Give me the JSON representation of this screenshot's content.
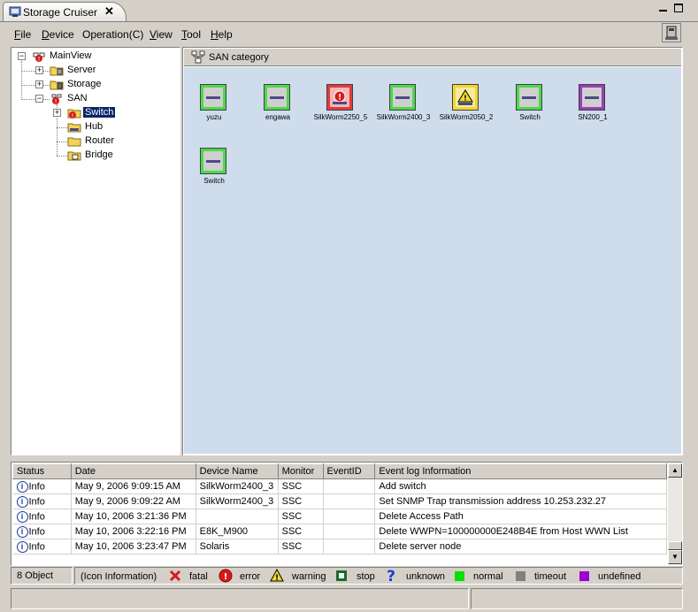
{
  "window": {
    "title": "Storage Cruiser",
    "close_glyph": "✕"
  },
  "menu": {
    "file": {
      "key": "F",
      "rest": "ile"
    },
    "device": {
      "key": "D",
      "rest": "evice"
    },
    "operation": "Operation(C)",
    "view": {
      "key": "V",
      "rest": "iew"
    },
    "tool": {
      "key": "T",
      "rest": "ool"
    },
    "help": {
      "key": "H",
      "rest": "elp"
    }
  },
  "tree": {
    "root": "MainView",
    "server": "Server",
    "storage": "Storage",
    "san": "SAN",
    "switch": "Switch",
    "hub": "Hub",
    "router": "Router",
    "bridge": "Bridge",
    "expand_plus": "+",
    "expand_minus": "−"
  },
  "category": {
    "title": "SAN category"
  },
  "devices": [
    {
      "label": "yuzu",
      "status": "normal"
    },
    {
      "label": "engawa",
      "status": "normal"
    },
    {
      "label": "SilkWorm2250_5",
      "status": "error"
    },
    {
      "label": "SilkWorm2400_3",
      "status": "normal"
    },
    {
      "label": "SilkWorm2050_2",
      "status": "warning"
    },
    {
      "label": "Switch",
      "status": "normal"
    },
    {
      "label": "SN200_1",
      "status": "undefined"
    },
    {
      "label": "Switch",
      "status": "normal"
    }
  ],
  "log": {
    "columns": [
      "Status",
      "Date",
      "Device Name",
      "Monitor",
      "EventID",
      "Event log Information"
    ],
    "rows": [
      {
        "status": "Info",
        "date": "May 9, 2006 9:09:15 AM",
        "device": "SilkWorm2400_3",
        "monitor": "SSC",
        "event_id": "",
        "info": "Add switch"
      },
      {
        "status": "Info",
        "date": "May 9, 2006 9:09:22 AM",
        "device": "SilkWorm2400_3",
        "monitor": "SSC",
        "event_id": "",
        "info": "Set SNMP Trap transmission address 10.253.232.27"
      },
      {
        "status": "Info",
        "date": "May 10, 2006 3:21:36 PM",
        "device": "",
        "monitor": "SSC",
        "event_id": "",
        "info": "Delete Access Path"
      },
      {
        "status": "Info",
        "date": "May 10, 2006 3:22:16 PM",
        "device": "E8K_M900",
        "monitor": "SSC",
        "event_id": "",
        "info": "Delete WWPN=100000000E248B4E from Host WWN List"
      },
      {
        "status": "Info",
        "date": "May 10, 2006 3:23:47 PM",
        "device": "Solaris",
        "monitor": "SSC",
        "event_id": "",
        "info": "Delete server node"
      }
    ]
  },
  "legend": {
    "count": "8 Object",
    "heading": "(Icon Information)",
    "fatal": "fatal",
    "error": "error",
    "warning": "warning",
    "stop": "stop",
    "unknown": "unknown",
    "normal": "normal",
    "timeout": "timeout",
    "undefined": "undefined"
  },
  "colors": {
    "normal": "#4cd94c",
    "error": "#e23b3b",
    "warning": "#f2d72e",
    "undefined": "#9a3fb5",
    "timeout": "#808080",
    "selection": "#0a246a",
    "canvas_bg": "#cfdcec"
  }
}
